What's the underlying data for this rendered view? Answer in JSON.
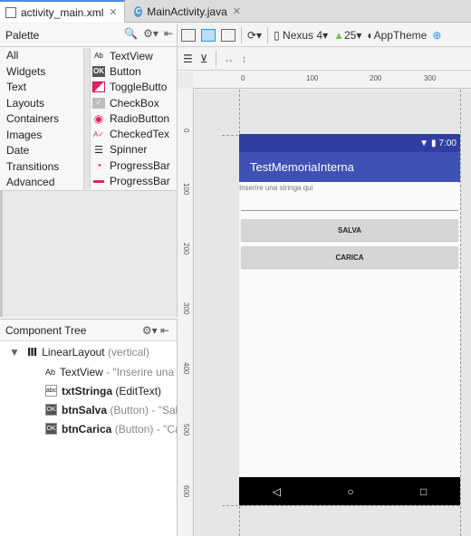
{
  "tabs": [
    {
      "label": "activity_main.xml",
      "icon": "layout-xml-icon",
      "active": true
    },
    {
      "label": "MainActivity.java",
      "icon": "class-c-icon",
      "active": false
    }
  ],
  "palette": {
    "title": "Palette",
    "categories": [
      "All",
      "Widgets",
      "Text",
      "Layouts",
      "Containers",
      "Images",
      "Date",
      "Transitions",
      "Advanced"
    ],
    "widgets": [
      {
        "label": "TextView",
        "icon": "Ab"
      },
      {
        "label": "Button",
        "icon": "OK"
      },
      {
        "label": "ToggleButto",
        "icon": "toggle"
      },
      {
        "label": "CheckBox",
        "icon": "check"
      },
      {
        "label": "RadioButton",
        "icon": "radio"
      },
      {
        "label": "CheckedTex",
        "icon": "checked-text"
      },
      {
        "label": "Spinner",
        "icon": "spinner"
      },
      {
        "label": "ProgressBar",
        "icon": "progress-circle"
      },
      {
        "label": "ProgressBar",
        "icon": "progress-line"
      }
    ]
  },
  "toolbar": {
    "device": "Nexus 4",
    "api": "25",
    "theme": "AppTheme"
  },
  "component_tree": {
    "title": "Component Tree",
    "items": [
      {
        "name": "LinearLayout",
        "detail": "(vertical)",
        "icon": "linear-layout"
      },
      {
        "name": "TextView",
        "detail": "- \"Inserire una s",
        "icon": "Ab"
      },
      {
        "name": "txtStringa",
        "detail": "(EditText)",
        "icon": "abc"
      },
      {
        "name": "btnSalva",
        "detail": "(Button) - \"Salv",
        "icon": "OK"
      },
      {
        "name": "btnCarica",
        "detail": "(Button) - \"Car",
        "icon": "OK"
      }
    ]
  },
  "ruler": {
    "h_labels": [
      "0",
      "100",
      "200",
      "300"
    ],
    "v_labels": [
      "0",
      "100",
      "200",
      "300",
      "400",
      "500",
      "600"
    ]
  },
  "device_preview": {
    "status_time": "7:00",
    "app_title": "TestMemoriaInterna",
    "hint_text": "Inserire una stringa qui",
    "button_save": "SALVA",
    "button_load": "CARICA",
    "colors": {
      "primary": "#3F51B5",
      "primary_dark": "#303F9F"
    }
  }
}
